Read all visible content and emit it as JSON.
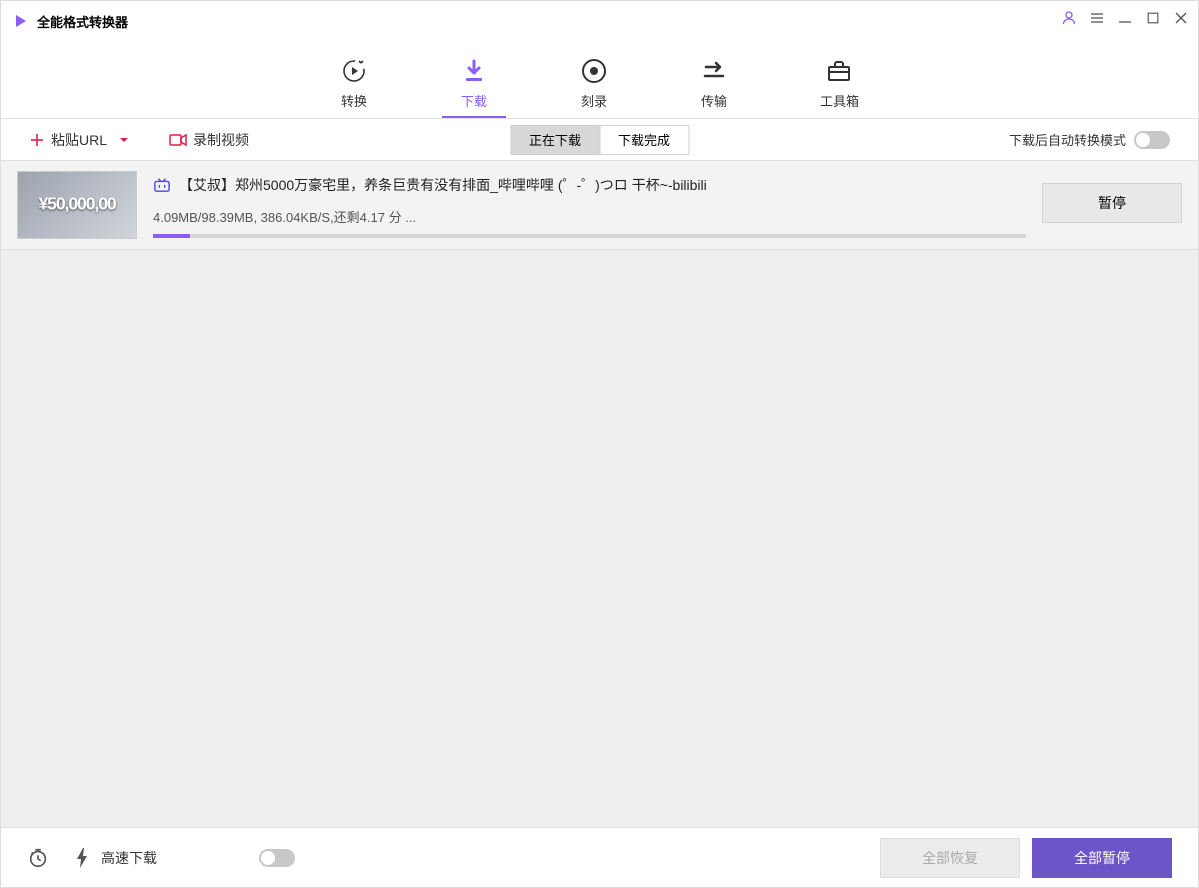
{
  "app": {
    "title": "全能格式转换器"
  },
  "nav": {
    "tabs": [
      {
        "label": "转换"
      },
      {
        "label": "下载"
      },
      {
        "label": "刻录"
      },
      {
        "label": "传输"
      },
      {
        "label": "工具箱"
      }
    ],
    "active_index": 1
  },
  "actionbar": {
    "paste_url_label": "粘贴URL",
    "record_label": "录制视频",
    "subtabs": {
      "downloading": "正在下载",
      "completed": "下载完成"
    },
    "auto_convert_label": "下载后自动转换模式"
  },
  "downloads": [
    {
      "thumb_text": "¥50,000,00",
      "title": "【艾叔】郑州5000万豪宅里，养条巨贵有没有排面_哔哩哔哩 (゜-゜)つロ 干杯~-bilibili",
      "stats": "4.09MB/98.39MB, 386.04KB/S,还剩4.17 分 ...",
      "progress_pct": 4.2,
      "action_label": "暂停"
    }
  ],
  "footer": {
    "speed_label": "高速下载",
    "resume_all": "全部恢复",
    "pause_all": "全部暂停"
  }
}
